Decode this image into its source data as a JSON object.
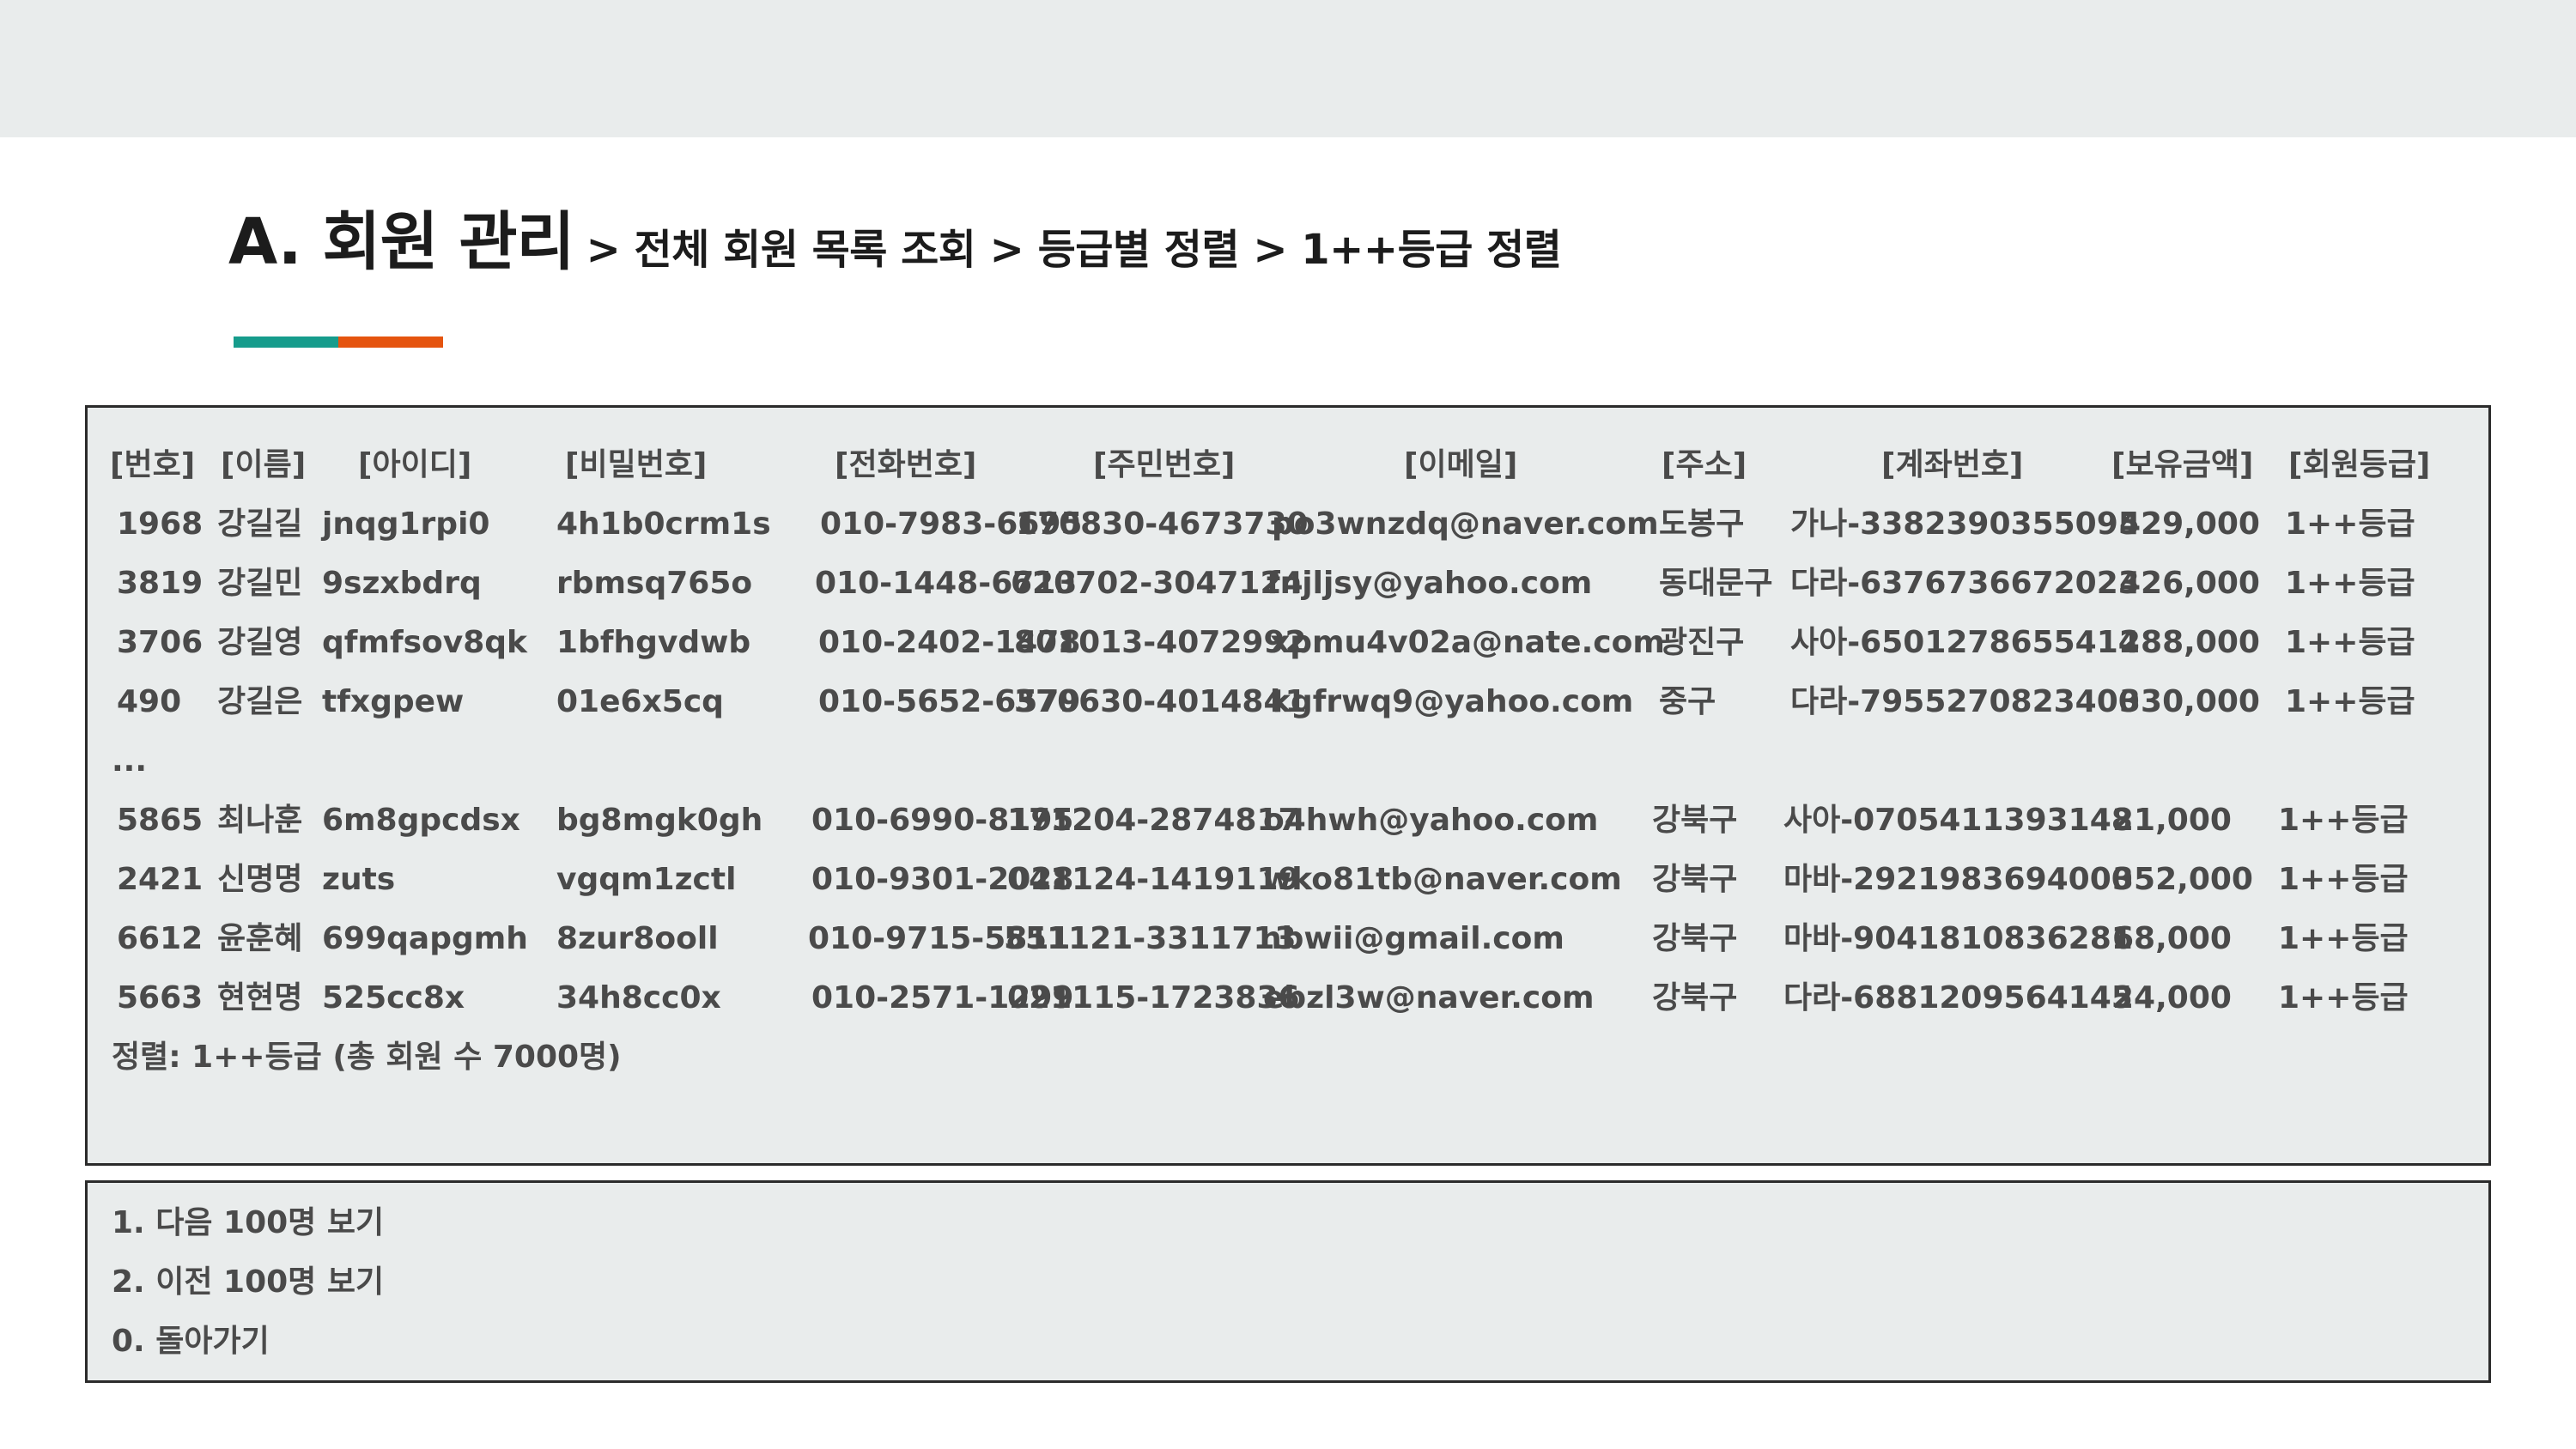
{
  "colors": {
    "accent_teal": "#169c8c",
    "accent_orange": "#e5540f",
    "panel_bg": "#e9ecec",
    "text": "#4a4a4a"
  },
  "title": {
    "main": "A. 회원 관리",
    "breadcrumb": "> 전체 회원 목록 조회 > 등급별 정렬 > 1++등급 정렬"
  },
  "table": {
    "headers": [
      "[번호]",
      "[이름]",
      "[아이디]",
      "[비밀번호]",
      "[전화번호]",
      "[주민번호]",
      "[이메일]",
      "[주소]",
      "[계좌번호]",
      "[보유금액]",
      "[회원등급]"
    ],
    "rows_top": [
      [
        "1968",
        "강길길",
        "jnqg1rpi0",
        "4h1b0crm1s",
        "010-7983-6695",
        "170830-4673730",
        "po3wnzdq@naver.com",
        "도봉구",
        "가나-3382390355095",
        "429,000",
        "1++등급"
      ],
      [
        "3819",
        "강길민",
        "9szxbdrq",
        "rbmsq765o",
        "010-1448-6713",
        "620702-3047124",
        "fnjljsy@yahoo.com",
        "동대문구",
        "다라-6376736672023",
        "426,000",
        "1++등급"
      ],
      [
        "3706",
        "강길영",
        "qfmfsov8qk",
        "1bfhgvdwb",
        "010-2402-1478",
        "801013-4072992",
        "xpmu4v02a@nate.com",
        "광진구",
        "사아-6501278655414",
        "288,000",
        "1++등급"
      ],
      [
        "490",
        "강길은",
        "tfxgpew",
        "01e6x5cq",
        "010-5652-6579",
        "370630-4014841",
        "kgfrwq9@yahoo.com",
        "중구",
        "다라-7955270823400",
        "330,000",
        "1++등급"
      ]
    ],
    "ellipsis": "...",
    "rows_bottom": [
      [
        "5865",
        "최나훈",
        "6m8gpcdsx",
        "bg8mgk0gh",
        "010-6990-8195",
        "171204-2874817",
        "o4hwh@yahoo.com",
        "강북구",
        "사아-0705411393148",
        "21,000",
        "1++등급"
      ],
      [
        "2421",
        "신명명",
        "zuts",
        "vgqm1zctl",
        "010-9301-2028",
        "041124-1419119",
        "wko81tb@naver.com",
        "강북구",
        "마바-2921983694000",
        "352,000",
        "1++등급"
      ],
      [
        "6612",
        "윤훈혜",
        "699qapgmh",
        "8zur8ooll",
        "010-9715-5811",
        "551121-3311713",
        "nbwii@gmail.com",
        "강북구",
        "마바-9041810836281",
        "68,000",
        "1++등급"
      ],
      [
        "5663",
        "현현명",
        "525cc8x",
        "34h8cc0x",
        "010-2571-1299",
        "021115-1723836",
        "ebzl3w@naver.com",
        "강북구",
        "다라-6881209564145",
        "24,000",
        "1++등급"
      ]
    ],
    "footer": "정렬: 1++등급 (총 회원 수 7000명)"
  },
  "menu": {
    "items": [
      "1. 다음 100명 보기",
      "2. 이전 100명 보기",
      "0. 돌아가기"
    ]
  }
}
